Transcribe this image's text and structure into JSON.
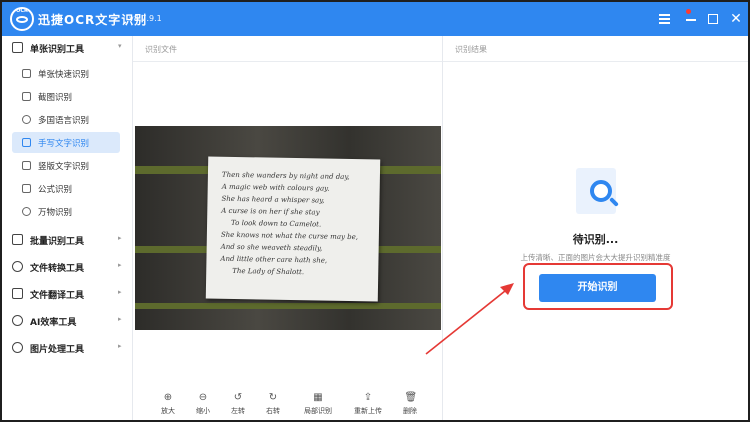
{
  "app": {
    "logo_text": "OCR",
    "title": "迅捷OCR文字识别",
    "version": "v8.7.9.1"
  },
  "window": {
    "close_glyph": "✕"
  },
  "sidebar": {
    "groups": [
      {
        "label": "单张识别工具",
        "expanded": true
      },
      {
        "label": "批量识别工具"
      },
      {
        "label": "文件转换工具"
      },
      {
        "label": "文件翻译工具"
      },
      {
        "label": "AI效率工具"
      },
      {
        "label": "图片处理工具"
      }
    ],
    "items": [
      {
        "label": "单张快速识别"
      },
      {
        "label": "截图识别"
      },
      {
        "label": "多国语言识别"
      },
      {
        "label": "手写文字识别",
        "active": true
      },
      {
        "label": "竖版文字识别"
      },
      {
        "label": "公式识别"
      },
      {
        "label": "万物识别"
      }
    ],
    "chevron": "▸",
    "chevron_open": "▾"
  },
  "file_panel": {
    "title": "识别文件",
    "note_lines": [
      "Then she wanders by night and day,",
      "A magic web with colours gay.",
      "She has heard a whisper say,",
      "A curse is on her if she stay",
      "To look down to Camelot.",
      "She knows not what the curse may be,",
      "And so she weaveth steadily,",
      "And little other care hath she,",
      "The Lady of Shalott."
    ],
    "toolbar": [
      {
        "label": "放大",
        "icon": "⊕"
      },
      {
        "label": "缩小",
        "icon": "⊖"
      },
      {
        "label": "左转",
        "icon": "↺"
      },
      {
        "label": "右转",
        "icon": "↻"
      },
      {
        "label": "局部识别",
        "icon": "▦"
      },
      {
        "label": "重新上传",
        "icon": "⇪"
      },
      {
        "label": "删除",
        "icon": "🗑"
      }
    ]
  },
  "result_panel": {
    "title": "识别结果",
    "status": "待识别...",
    "hint": "上传清晰、正面的图片会大大提升识别精准度",
    "start_label": "开始识别"
  },
  "colors": {
    "brand": "#2f87f0",
    "highlight": "#e53935"
  }
}
